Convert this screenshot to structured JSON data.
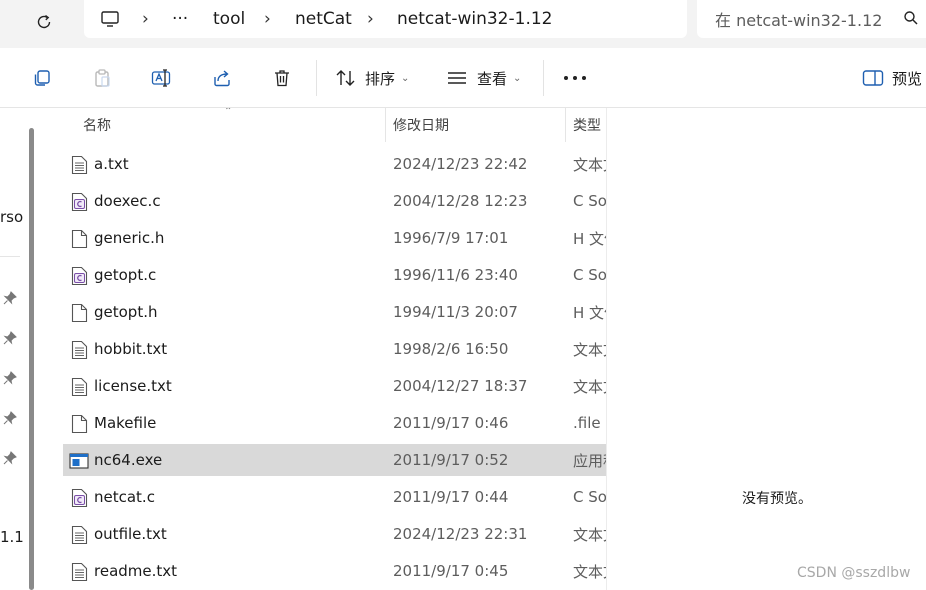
{
  "address_bar": {
    "breadcrumb": [
      "tool",
      "netCat",
      "netcat-win32-1.12"
    ],
    "search_placeholder": "在 netcat-win32-1.12"
  },
  "toolbar": {
    "sort_label": "排序",
    "view_label": "查看",
    "preview_label": "预览"
  },
  "nav_pane": {
    "partial_texts": [
      "rso",
      "1.1"
    ]
  },
  "columns": {
    "name": "名称",
    "modified": "修改日期",
    "type": "类型"
  },
  "files": [
    {
      "name": "a.txt",
      "date": "2024/12/23 22:42",
      "type": "文本文档",
      "icon": "text-file-icon"
    },
    {
      "name": "doexec.c",
      "date": "2004/12/28 12:23",
      "type": "C Source",
      "icon": "c-source-file-icon"
    },
    {
      "name": "generic.h",
      "date": "1996/7/9 17:01",
      "type": "H 文件",
      "icon": "blank-file-icon"
    },
    {
      "name": "getopt.c",
      "date": "1996/11/6 23:40",
      "type": "C Source",
      "icon": "c-source-file-icon"
    },
    {
      "name": "getopt.h",
      "date": "1994/11/3 20:07",
      "type": "H 文件",
      "icon": "blank-file-icon"
    },
    {
      "name": "hobbit.txt",
      "date": "1998/2/6 16:50",
      "type": "文本文档",
      "icon": "text-file-icon"
    },
    {
      "name": "license.txt",
      "date": "2004/12/27 18:37",
      "type": "文本文档",
      "icon": "text-file-icon"
    },
    {
      "name": "Makefile",
      "date": "2011/9/17 0:46",
      "type": ".file",
      "icon": "blank-file-icon"
    },
    {
      "name": "nc64.exe",
      "date": "2011/9/17 0:52",
      "type": "应用程序",
      "icon": "exe-file-icon",
      "selected": true
    },
    {
      "name": "netcat.c",
      "date": "2011/9/17 0:44",
      "type": "C Source",
      "icon": "c-source-file-icon"
    },
    {
      "name": "outfile.txt",
      "date": "2024/12/23 22:31",
      "type": "文本文档",
      "icon": "text-file-icon"
    },
    {
      "name": "readme.txt",
      "date": "2011/9/17 0:45",
      "type": "文本文档",
      "icon": "text-file-icon"
    }
  ],
  "preview_pane": {
    "message": "没有预览。",
    "watermark": "CSDN @sszdlbw"
  },
  "colors": {
    "selection": "#d9d9d9",
    "chrome": "#f3f3f3",
    "exe_icon_blue": "#1e6fc8",
    "c_icon_purple": "#7b4fa8"
  }
}
